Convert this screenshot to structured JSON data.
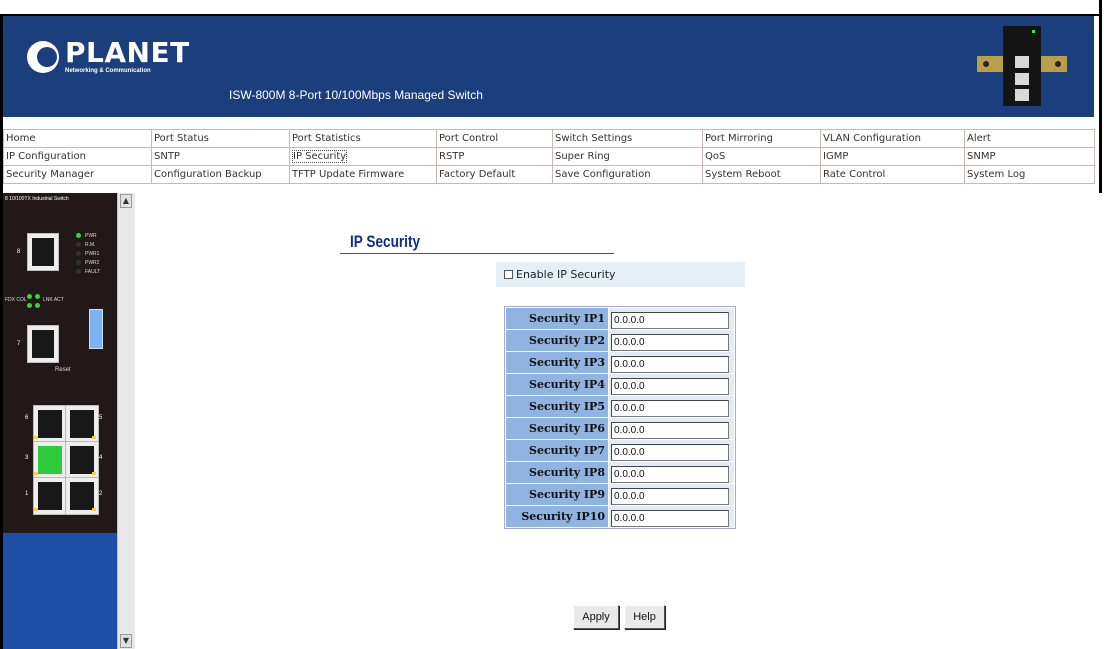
{
  "header": {
    "logo_word": "PLANET",
    "logo_tagline": "Networking & Communication",
    "product_title": "ISW-800M 8-Port 10/100Mbps Managed Switch"
  },
  "menu": {
    "rows": [
      [
        "Home",
        "Port Status",
        "Port Statistics",
        "Port Control",
        "Switch Settings",
        "Port Mirroring",
        "VLAN Configuration",
        "Alert"
      ],
      [
        "IP Configuration",
        "SNTP",
        "IP Security",
        "RSTP",
        "Super Ring",
        "QoS",
        "IGMP",
        "SNMP"
      ],
      [
        "Security Manager",
        "Configuration Backup",
        "TFTP Update Firmware",
        "Factory Default",
        "Save Configuration",
        "System Reboot",
        "Rate Control",
        "System Log"
      ]
    ],
    "active": "IP Security"
  },
  "device_panel": {
    "title": "8 10/100TX Industrial Switch",
    "led_labels": [
      "PWR",
      "R.M.",
      "PWR1",
      "PWR2",
      "FAULT"
    ],
    "link_labels": [
      "FDX COL",
      "LNK ACT"
    ],
    "reset_label": "Reset",
    "port_numbers": [
      "8",
      "7",
      "6",
      "5",
      "3",
      "4",
      "1",
      "2"
    ]
  },
  "page": {
    "title": "IP Security",
    "enable_label": "Enable IP Security",
    "enable_checked": false
  },
  "security_ips": [
    {
      "label": "Security IP1",
      "value": "0.0.0.0"
    },
    {
      "label": "Security IP2",
      "value": "0.0.0.0"
    },
    {
      "label": "Security IP3",
      "value": "0.0.0.0"
    },
    {
      "label": "Security IP4",
      "value": "0.0.0.0"
    },
    {
      "label": "Security IP5",
      "value": "0.0.0.0"
    },
    {
      "label": "Security IP6",
      "value": "0.0.0.0"
    },
    {
      "label": "Security IP7",
      "value": "0.0.0.0"
    },
    {
      "label": "Security IP8",
      "value": "0.0.0.0"
    },
    {
      "label": "Security IP9",
      "value": "0.0.0.0"
    },
    {
      "label": "Security IP10",
      "value": "0.0.0.0"
    }
  ],
  "buttons": {
    "apply": "Apply",
    "help": "Help"
  },
  "colors": {
    "header_bg": "#1b3f7d",
    "panel_bg": "#1f4ea7",
    "label_cell": "#8fb4e2",
    "title_text": "#0c2d8c"
  }
}
